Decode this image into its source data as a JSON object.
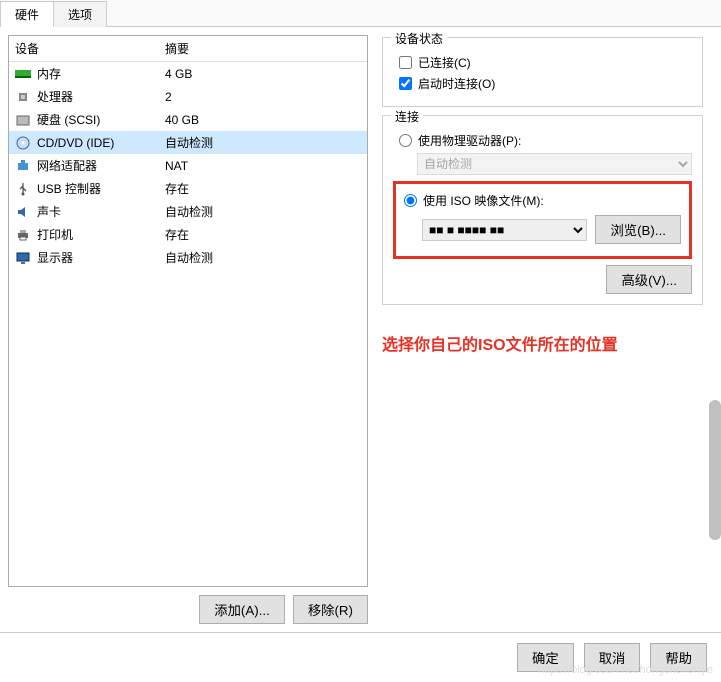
{
  "tabs": {
    "hardware": "硬件",
    "options": "选项"
  },
  "columns": {
    "device": "设备",
    "summary": "摘要"
  },
  "devices": [
    {
      "icon": "memory-icon",
      "name": "内存",
      "summary": "4 GB",
      "selected": false
    },
    {
      "icon": "cpu-icon",
      "name": "处理器",
      "summary": "2",
      "selected": false
    },
    {
      "icon": "disk-icon",
      "name": "硬盘 (SCSI)",
      "summary": "40 GB",
      "selected": false
    },
    {
      "icon": "cd-icon",
      "name": "CD/DVD (IDE)",
      "summary": "自动检测",
      "selected": true
    },
    {
      "icon": "network-icon",
      "name": "网络适配器",
      "summary": "NAT",
      "selected": false
    },
    {
      "icon": "usb-icon",
      "name": "USB 控制器",
      "summary": "存在",
      "selected": false
    },
    {
      "icon": "sound-icon",
      "name": "声卡",
      "summary": "自动检测",
      "selected": false
    },
    {
      "icon": "printer-icon",
      "name": "打印机",
      "summary": "存在",
      "selected": false
    },
    {
      "icon": "display-icon",
      "name": "显示器",
      "summary": "自动检测",
      "selected": false
    }
  ],
  "left_buttons": {
    "add": "添加(A)...",
    "remove": "移除(R)"
  },
  "status_group": {
    "title": "设备状态",
    "connected": {
      "label": "已连接(C)",
      "checked": false
    },
    "connect_on_power": {
      "label": "启动时连接(O)",
      "checked": true
    }
  },
  "conn_group": {
    "title": "连接",
    "physical": {
      "label": "使用物理驱动器(P):",
      "selected": "自动检测"
    },
    "iso": {
      "label": "使用 ISO 映像文件(M):",
      "path_masked": "■■ ■ ■■■■ ■■",
      "browse": "浏览(B)..."
    },
    "advanced": "高级(V)..."
  },
  "annotation": "选择你自己的ISO文件所在的位置",
  "footer": {
    "ok": "确定",
    "cancel": "取消",
    "help": "帮助"
  },
  "watermark": "https://blog.csdn.net/hongchenshijie"
}
